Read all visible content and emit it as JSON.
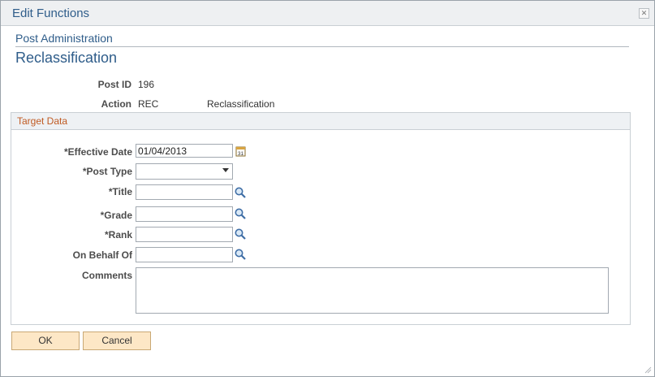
{
  "window": {
    "title": "Edit Functions",
    "close_label": "✕"
  },
  "breadcrumb": "Post Administration",
  "page_title": "Reclassification",
  "info": {
    "post_id_label": "Post ID",
    "post_id_value": "196",
    "action_label": "Action",
    "action_code": "REC",
    "action_desc": "Reclassification"
  },
  "target": {
    "header": "Target Data",
    "effective_date_label": "*Effective Date",
    "effective_date_value": "01/04/2013",
    "post_type_label": "*Post Type",
    "post_type_value": "",
    "title_label": "*Title",
    "title_value": "",
    "grade_label": "*Grade",
    "grade_value": "",
    "rank_label": "*Rank",
    "rank_value": "",
    "behalf_label": "On Behalf Of",
    "behalf_value": "",
    "comments_label": "Comments",
    "comments_value": ""
  },
  "buttons": {
    "ok": "OK",
    "cancel": "Cancel"
  },
  "colors": {
    "accent": "#2f5d8a",
    "group_header": "#c05a22",
    "button_bg": "#fde7c6"
  },
  "icons": {
    "calendar": "calendar-icon",
    "lookup": "magnifier-icon"
  }
}
